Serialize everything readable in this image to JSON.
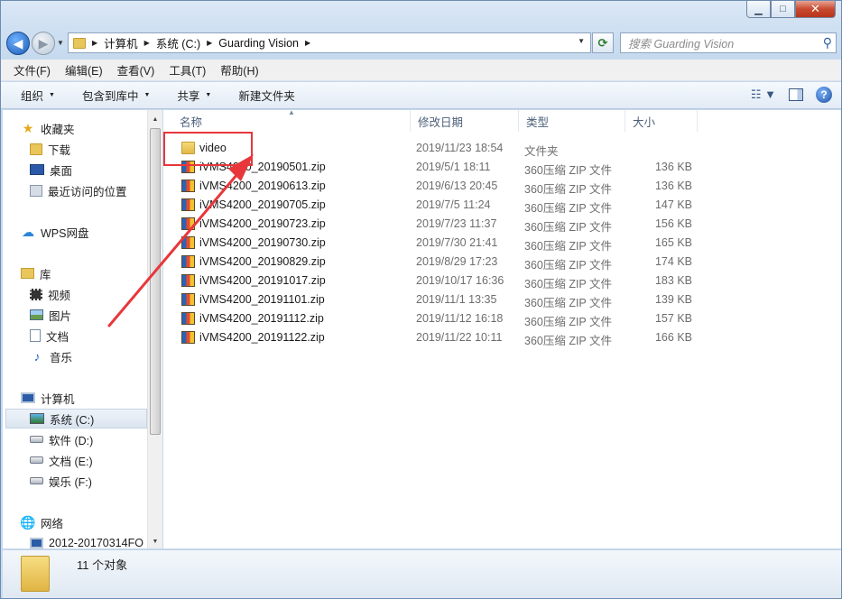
{
  "window": {
    "buttons": {
      "minimize": "▁",
      "maximize": "□",
      "close": "✕"
    }
  },
  "address": {
    "crumbs": [
      "计算机",
      "系统 (C:)",
      "Guarding Vision"
    ],
    "search_placeholder": "搜索 Guarding Vision"
  },
  "menu": [
    "文件(F)",
    "编辑(E)",
    "查看(V)",
    "工具(T)",
    "帮助(H)"
  ],
  "commands": [
    "组织",
    "包含到库中",
    "共享",
    "新建文件夹"
  ],
  "navpane": {
    "favorites": "收藏夹",
    "downloads": "下载",
    "desktop": "桌面",
    "recent": "最近访问的位置",
    "wps": "WPS网盘",
    "libraries": "库",
    "videos": "视频",
    "pictures": "图片",
    "documents": "文档",
    "music": "音乐",
    "computer": "计算机",
    "drive_c": "系统 (C:)",
    "drive_d": "软件 (D:)",
    "drive_e": "文档 (E:)",
    "drive_f": "娱乐 (F:)",
    "network": "网络",
    "host": "2012-20170314FO"
  },
  "columns": {
    "name": "名称",
    "date": "修改日期",
    "type": "类型",
    "size": "大小"
  },
  "files": [
    {
      "name": "video",
      "date": "2019/11/23 18:54",
      "type": "文件夹",
      "size": "",
      "kind": "folder"
    },
    {
      "name": "iVMS4200_20190501.zip",
      "date": "2019/5/1 18:11",
      "type": "360压缩 ZIP 文件",
      "size": "136 KB",
      "kind": "zip"
    },
    {
      "name": "iVMS4200_20190613.zip",
      "date": "2019/6/13 20:45",
      "type": "360压缩 ZIP 文件",
      "size": "136 KB",
      "kind": "zip"
    },
    {
      "name": "iVMS4200_20190705.zip",
      "date": "2019/7/5 11:24",
      "type": "360压缩 ZIP 文件",
      "size": "147 KB",
      "kind": "zip"
    },
    {
      "name": "iVMS4200_20190723.zip",
      "date": "2019/7/23 11:37",
      "type": "360压缩 ZIP 文件",
      "size": "156 KB",
      "kind": "zip"
    },
    {
      "name": "iVMS4200_20190730.zip",
      "date": "2019/7/30 21:41",
      "type": "360压缩 ZIP 文件",
      "size": "165 KB",
      "kind": "zip"
    },
    {
      "name": "iVMS4200_20190829.zip",
      "date": "2019/8/29 17:23",
      "type": "360压缩 ZIP 文件",
      "size": "174 KB",
      "kind": "zip"
    },
    {
      "name": "iVMS4200_20191017.zip",
      "date": "2019/10/17 16:36",
      "type": "360压缩 ZIP 文件",
      "size": "183 KB",
      "kind": "zip"
    },
    {
      "name": "iVMS4200_20191101.zip",
      "date": "2019/11/1 13:35",
      "type": "360压缩 ZIP 文件",
      "size": "139 KB",
      "kind": "zip"
    },
    {
      "name": "iVMS4200_20191112.zip",
      "date": "2019/11/12 16:18",
      "type": "360压缩 ZIP 文件",
      "size": "157 KB",
      "kind": "zip"
    },
    {
      "name": "iVMS4200_20191122.zip",
      "date": "2019/11/22 10:11",
      "type": "360压缩 ZIP 文件",
      "size": "166 KB",
      "kind": "zip"
    }
  ],
  "status": {
    "count": "11 个对象"
  },
  "annotation": {
    "color": "#e8363a"
  }
}
